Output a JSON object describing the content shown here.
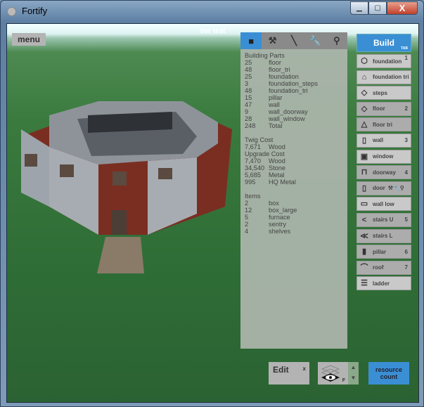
{
  "window": {
    "title": "Fortify",
    "minimize": "▁",
    "maximize": "▢",
    "close": "X"
  },
  "scene": {
    "overlay_text": "tier test",
    "menu_label": "menu"
  },
  "panel": {
    "tabs": [
      {
        "icon": "building-block-icon",
        "glyph": "■",
        "active": true
      },
      {
        "icon": "hammer-icon",
        "glyph": "⚒"
      },
      {
        "icon": "trowel-icon",
        "glyph": "╲"
      },
      {
        "icon": "wrench-icon",
        "glyph": "🔧"
      },
      {
        "icon": "key-wrench-icon",
        "glyph": "⚲"
      }
    ],
    "building_parts_title": "Building Parts",
    "building_parts": [
      {
        "n": "25",
        "name": "floor"
      },
      {
        "n": "48",
        "name": "floor_tri"
      },
      {
        "n": "25",
        "name": "foundation"
      },
      {
        "n": "3",
        "name": "foundation_steps"
      },
      {
        "n": "48",
        "name": "foundation_tri"
      },
      {
        "n": "15",
        "name": "pillar"
      },
      {
        "n": "47",
        "name": "wall"
      },
      {
        "n": "9",
        "name": "wall_doorway"
      },
      {
        "n": "28",
        "name": "wall_window"
      },
      {
        "n": "248",
        "name": "Total"
      }
    ],
    "twig_title": "Twig Cost",
    "twig": [
      {
        "n": "7,671",
        "name": "Wood"
      }
    ],
    "upgrade_title": "Upgrade Cost",
    "upgrade": [
      {
        "n": "7,470",
        "name": "Wood"
      },
      {
        "n": "34,540",
        "name": "Stone"
      },
      {
        "n": "5,685",
        "name": "Metal"
      },
      {
        "n": "995",
        "name": "HQ Metal"
      }
    ],
    "items_title": "Items",
    "items": [
      {
        "n": "2",
        "name": "box"
      },
      {
        "n": "12",
        "name": "box_large"
      },
      {
        "n": "5",
        "name": "furnace"
      },
      {
        "n": "2",
        "name": "sentry"
      },
      {
        "n": "4",
        "name": "shelves"
      }
    ]
  },
  "build": {
    "label": "Build",
    "key": "TAB",
    "buttons": [
      {
        "label": "foundation",
        "icon": "cube-icon",
        "glyph": "⬡",
        "key": "1"
      },
      {
        "label": "foundation tri",
        "icon": "tri-prism-icon",
        "glyph": "⌂",
        "key": ""
      },
      {
        "label": "steps",
        "icon": "steps-icon",
        "glyph": "◇",
        "key": ""
      },
      {
        "label": "floor",
        "icon": "floor-icon",
        "glyph": "◇",
        "key": "2"
      },
      {
        "label": "floor tri",
        "icon": "floor-tri-icon",
        "glyph": "△",
        "key": ""
      },
      {
        "label": "wall",
        "icon": "wall-icon",
        "glyph": "▯",
        "key": "3"
      },
      {
        "label": "window",
        "icon": "window-icon",
        "glyph": "▣",
        "key": ""
      },
      {
        "label": "doorway",
        "icon": "doorway-icon",
        "glyph": "⊓",
        "key": "4"
      },
      {
        "label": "door",
        "icon": "door-icon",
        "glyph": "▯",
        "key": "",
        "extra": "⚒🔧⚲"
      },
      {
        "label": "wall low",
        "icon": "wall-low-icon",
        "glyph": "▭",
        "key": ""
      },
      {
        "label": "stairs U",
        "icon": "stairs-u-icon",
        "glyph": "<",
        "key": "5"
      },
      {
        "label": "stairs L",
        "icon": "stairs-l-icon",
        "glyph": "≪",
        "key": ""
      },
      {
        "label": "pillar",
        "icon": "pillar-icon",
        "glyph": "▮",
        "key": "6"
      },
      {
        "label": "roof",
        "icon": "roof-icon",
        "glyph": "⌒",
        "key": "7"
      },
      {
        "label": "ladder",
        "icon": "ladder-icon",
        "glyph": "☰",
        "key": ""
      }
    ]
  },
  "bottom": {
    "edit_label": "Edit",
    "edit_close": "x",
    "layers_key": "F",
    "up": "▲",
    "down": "▼",
    "resource_count": "resource count"
  },
  "colors": {
    "accent": "#3a8fd4",
    "ground": "#3a7a3e",
    "brick": "#7a2e22",
    "concrete": "#a7acb2"
  }
}
